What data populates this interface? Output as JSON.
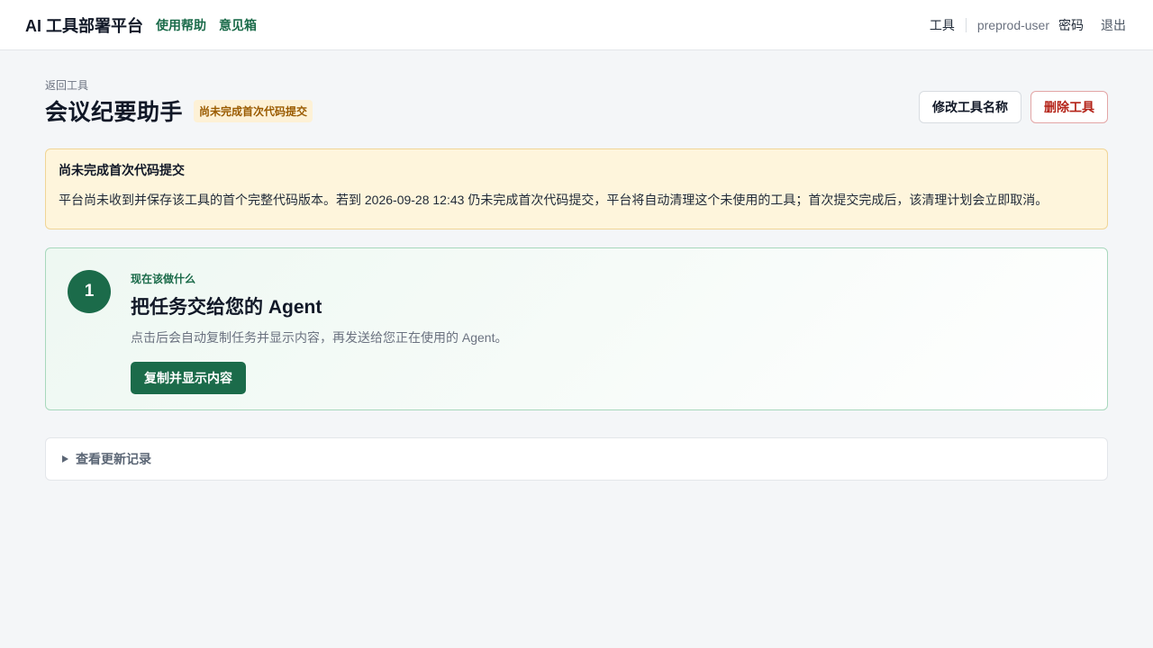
{
  "header": {
    "brand": "AI 工具部署平台",
    "nav": [
      "使用帮助",
      "意见箱"
    ],
    "tools_link": "工具",
    "username": "preprod-user",
    "password_link": "密码",
    "logout_link": "退出"
  },
  "page": {
    "back_link": "返回工具",
    "title": "会议纪要助手",
    "status_badge": "尚未完成首次代码提交",
    "rename_button": "修改工具名称",
    "delete_button": "删除工具"
  },
  "notice": {
    "title": "尚未完成首次代码提交",
    "body": "平台尚未收到并保存该工具的首个完整代码版本。若到 2026-09-28 12:43 仍未完成首次代码提交，平台将自动清理这个未使用的工具；首次提交完成后，该清理计划会立即取消。"
  },
  "step": {
    "number": "1",
    "eyebrow": "现在该做什么",
    "title": "把任务交给您的 Agent",
    "description": "点击后会自动复制任务并显示内容，再发送给您正在使用的 Agent。",
    "button": "复制并显示内容"
  },
  "changelog": {
    "label": "查看更新记录"
  },
  "colors": {
    "accent": "#1b6b4a",
    "warning_bg": "#fef5dc",
    "danger": "#b42318"
  },
  "icons": {
    "changelog_toggle": "triangle-right-icon"
  }
}
